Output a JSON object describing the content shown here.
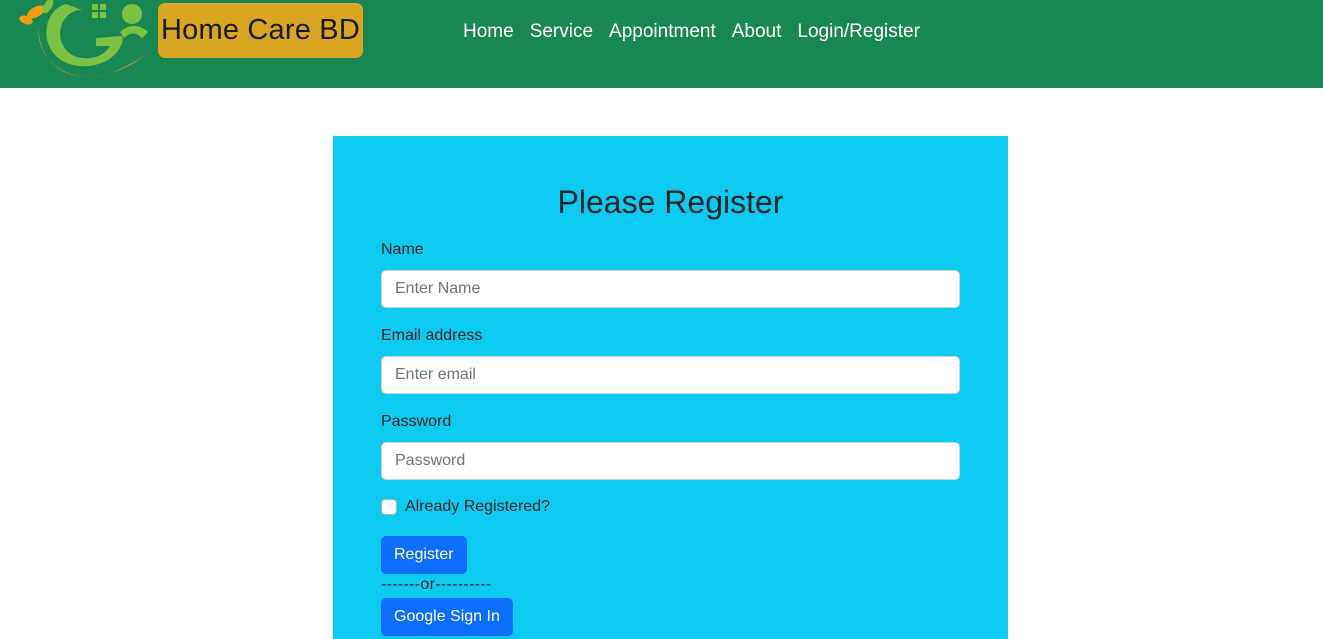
{
  "navbar": {
    "brand": "Home Care BD",
    "logo_icon": "home-care-leaf-logo",
    "links": [
      "Home",
      "Service",
      "Appointment",
      "About",
      "Login/Register"
    ],
    "background": "#198754",
    "brand_background": "#daa520"
  },
  "form": {
    "title": "Please Register",
    "name_label": "Name",
    "name_placeholder": "Enter Name",
    "email_label": "Email address",
    "email_placeholder": "Enter email",
    "password_label": "Password",
    "password_placeholder": "Password",
    "checkbox_label": "Already Registered?",
    "checkbox_checked": false,
    "register_button": "Register",
    "divider": "-------or----------",
    "google_button": "Google Sign In",
    "card_background": "#0dcaf0",
    "button_color": "#0d6efd"
  }
}
